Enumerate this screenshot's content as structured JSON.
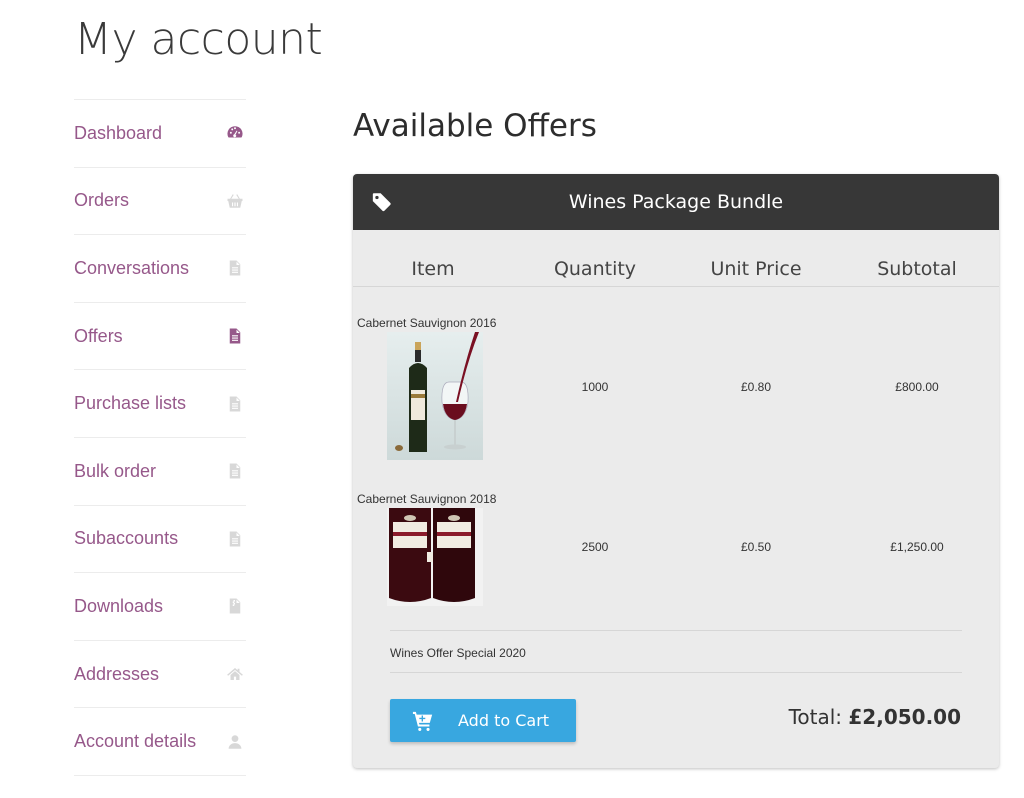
{
  "page": {
    "title": "My account"
  },
  "sidebar": {
    "items": [
      {
        "label": "Dashboard",
        "icon": "dashboard-icon"
      },
      {
        "label": "Orders",
        "icon": "basket-icon"
      },
      {
        "label": "Conversations",
        "icon": "file-icon"
      },
      {
        "label": "Offers",
        "icon": "file-icon",
        "active": true
      },
      {
        "label": "Purchase lists",
        "icon": "file-icon"
      },
      {
        "label": "Bulk order",
        "icon": "file-icon"
      },
      {
        "label": "Subaccounts",
        "icon": "file-icon"
      },
      {
        "label": "Downloads",
        "icon": "file-download-icon"
      },
      {
        "label": "Addresses",
        "icon": "home-icon"
      },
      {
        "label": "Account details",
        "icon": "user-icon"
      }
    ]
  },
  "main": {
    "title": "Available Offers",
    "offer": {
      "name": "Wines Package Bundle",
      "columns": [
        "Item",
        "Quantity",
        "Unit Price",
        "Subtotal"
      ],
      "rows": [
        {
          "item": "Cabernet Sauvignon 2016",
          "quantity": "1000",
          "unit_price": "£0.80",
          "subtotal": "£800.00"
        },
        {
          "item": "Cabernet Sauvignon 2018",
          "quantity": "2500",
          "unit_price": "£0.50",
          "subtotal": "£1,250.00"
        }
      ],
      "note": "Wines Offer Special 2020",
      "add_to_cart_label": "Add to Cart",
      "total_label": "Total: ",
      "total_value": "£2,050.00"
    }
  },
  "colors": {
    "link": "#96588a",
    "header_bg": "#373737",
    "card_bg": "#ebebeb",
    "button_bg": "#38a7e0"
  }
}
